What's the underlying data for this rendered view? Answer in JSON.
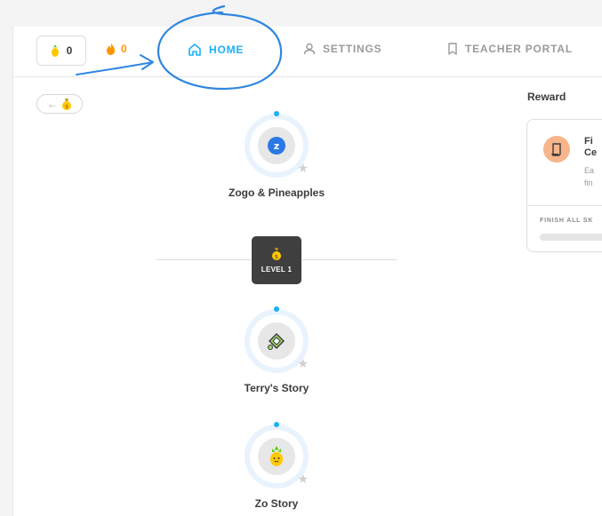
{
  "topbar": {
    "pineapple_count": "0",
    "streak_count": "0",
    "nav": [
      {
        "label": "HOME",
        "icon": "home-icon",
        "active": true
      },
      {
        "label": "SETTINGS",
        "icon": "user-icon",
        "active": false
      },
      {
        "label": "TEACHER PORTAL",
        "icon": "bookmark-icon",
        "active": false
      }
    ]
  },
  "back_chip": {
    "arrow": "←",
    "icon": "money-bag-icon"
  },
  "path": {
    "skills": [
      {
        "label": "Zogo & Pineapples",
        "icon": "zogo-logo-icon"
      },
      {
        "label": "Terry's Story",
        "icon": "turtle-icon"
      },
      {
        "label": "Zo Story",
        "icon": "pineapple-icon"
      }
    ],
    "level": {
      "label": "LEVEL 1",
      "icon": "money-bag-icon"
    }
  },
  "reward": {
    "title": "Reward",
    "card_name_line1": "Fi",
    "card_name_line2": "Ce",
    "card_desc_line1": "Ea",
    "card_desc_line2": "fin",
    "progress_label": "FINISH ALL SK",
    "progress": 0.0
  },
  "colors": {
    "accent": "#1cb0f6",
    "streak": "#ff9600",
    "level_badge": "#3f3f3f",
    "annotation": "#2f86e0"
  }
}
